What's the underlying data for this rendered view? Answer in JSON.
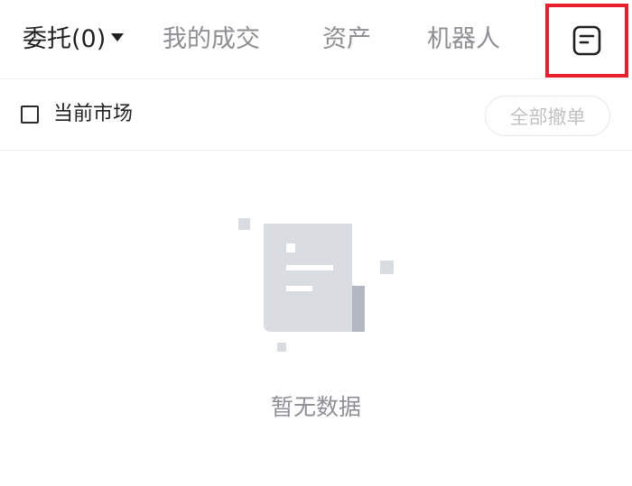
{
  "tabs": {
    "entrust_label": "委托(0)",
    "trades_label": "我的成交",
    "assets_label": "资产",
    "robot_label": "机器人",
    "records_icon": "document-list-icon"
  },
  "filter": {
    "current_market_label": "当前市场",
    "current_market_checked": false,
    "cancel_all_label": "全部撤单"
  },
  "empty_state": {
    "icon": "empty-document-icon",
    "text": "暂无数据"
  },
  "colors": {
    "highlight_border": "#e8202e",
    "active_tab": "#1f1f1f",
    "inactive_tab": "#8e8e93",
    "illustration": "#d9dce1"
  }
}
